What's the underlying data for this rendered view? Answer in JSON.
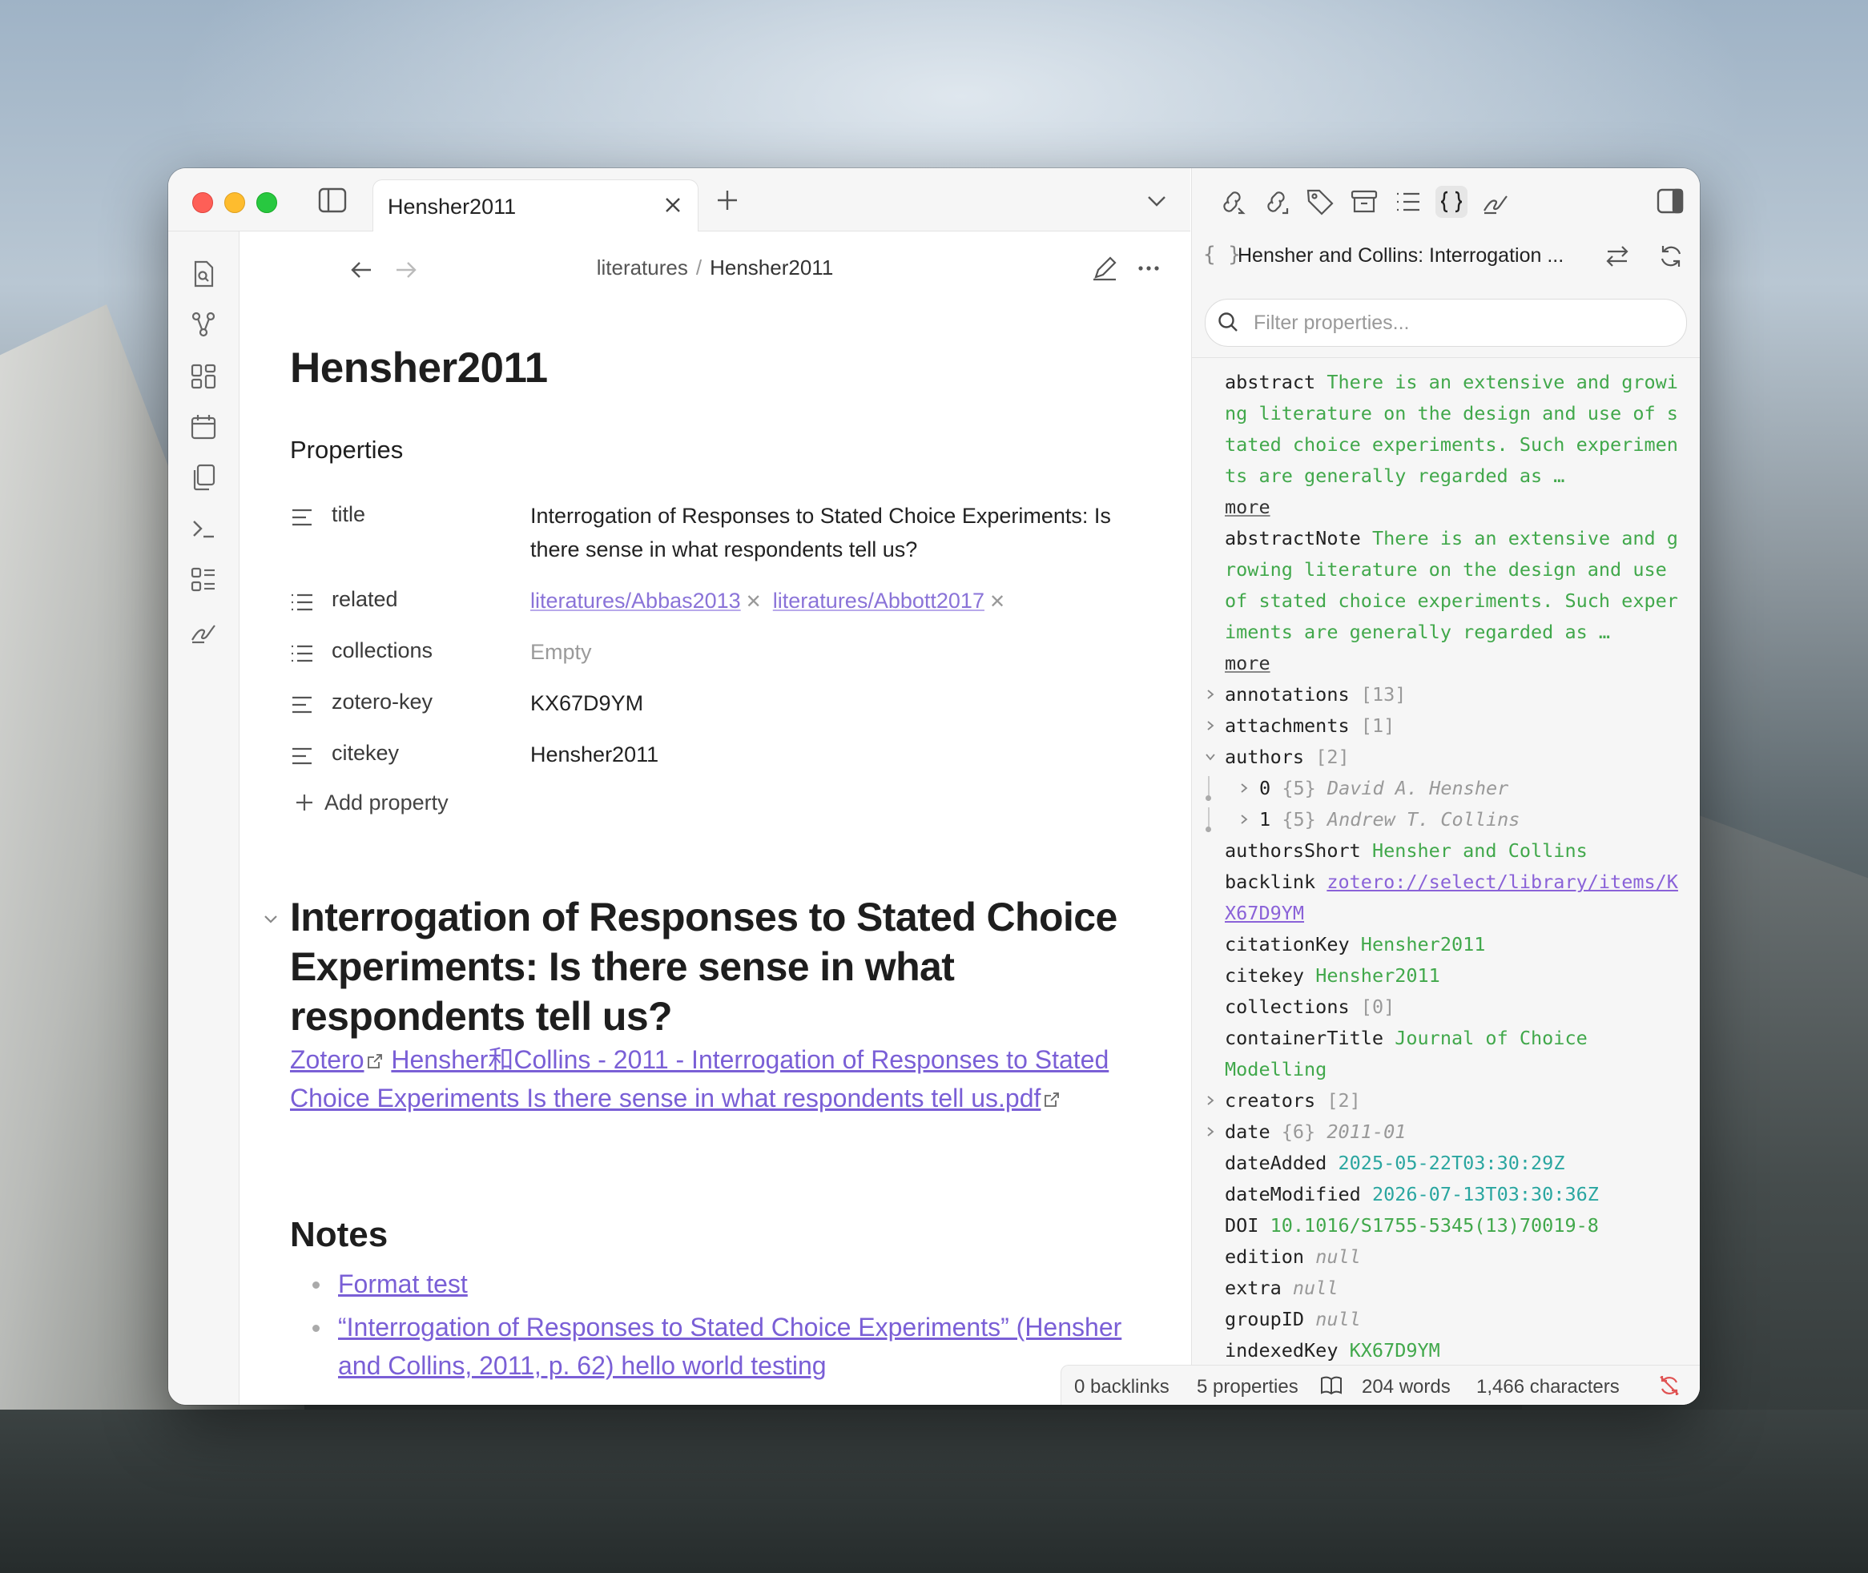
{
  "tab": {
    "title": "Hensher2011"
  },
  "breadcrumb": {
    "folder": "literatures",
    "separator": "/",
    "current": "Hensher2011"
  },
  "note": {
    "title": "Hensher2011",
    "properties_heading": "Properties",
    "properties": [
      {
        "key": "title",
        "value": "Interrogation of Responses to Stated Choice Experiments: Is there sense in what respondents tell us?"
      },
      {
        "key": "related",
        "links": [
          "literatures/Abbas2013",
          "literatures/Abbott2017"
        ]
      },
      {
        "key": "collections",
        "value": "Empty"
      },
      {
        "key": "zotero-key",
        "value": "KX67D9YM"
      },
      {
        "key": "citekey",
        "value": "Hensher2011"
      }
    ],
    "add_property": "Add property",
    "heading": "Interrogation of Responses to Stated Choice Experiments: Is there sense in what respondents tell us?",
    "zotero_link": "Zotero",
    "pdf_link": "Hensher和Collins - 2011 - Interrogation of Responses to Stated Choice Experiments Is there sense in what respondents tell us.pdf",
    "notes_heading": "Notes",
    "notes": [
      "Format test",
      "“Interrogation of Responses to Stated Choice Experiments” (Hensher and Collins, 2011, p. 62) hello world testing"
    ]
  },
  "right_panel": {
    "brace": "{ }",
    "title": "Hensher and Collins: Interrogation ...",
    "filter_placeholder": "Filter properties...",
    "abstract_key": "abstract",
    "abstract_text": "There is an extensive and growing literature on the design and use of stated choice experiments. Such experiments are generally regarded as …",
    "abstractNote_key": "abstractNote",
    "abstractNote_text": "There is an extensive and growing literature on the design and use of stated choice experiments. Such experiments are generally regarded as …",
    "more": "more",
    "annotations": {
      "key": "annotations",
      "count": "[13]"
    },
    "attachments": {
      "key": "attachments",
      "count": "[1]"
    },
    "authors": {
      "key": "authors",
      "count": "[2]"
    },
    "author0": {
      "index": "0",
      "count": "{5}",
      "name": "David A. Hensher"
    },
    "author1": {
      "index": "1",
      "count": "{5}",
      "name": "Andrew T. Collins"
    },
    "authorsShort": {
      "key": "authorsShort",
      "value": "Hensher and Collins"
    },
    "backlink": {
      "key": "backlink",
      "value": "zotero://select/library/items/KX67D9YM"
    },
    "citationKey": {
      "key": "citationKey",
      "value": "Hensher2011"
    },
    "citekey": {
      "key": "citekey",
      "value": "Hensher2011"
    },
    "collections": {
      "key": "collections",
      "count": "[0]"
    },
    "containerTitle": {
      "key": "containerTitle",
      "value": "Journal of Choice Modelling"
    },
    "creators": {
      "key": "creators",
      "count": "[2]"
    },
    "date": {
      "key": "date",
      "count": "{6}",
      "value": "2011-01"
    },
    "dateAdded": {
      "key": "dateAdded",
      "value": "2025-05-22T03:30:29Z"
    },
    "dateModified": {
      "key": "dateModified",
      "value": "2026-07-13T03:30:36Z"
    },
    "DOI": {
      "key": "DOI",
      "value": "10.1016/S1755-5345(13)70019-8"
    },
    "edition": {
      "key": "edition",
      "value": "null"
    },
    "extra": {
      "key": "extra",
      "value": "null"
    },
    "groupID": {
      "key": "groupID",
      "value": "null"
    },
    "indexedKey": {
      "key": "indexedKey",
      "value": "KX67D9YM"
    }
  },
  "status": {
    "backlinks": "0 backlinks",
    "properties": "5 properties",
    "words": "204 words",
    "characters": "1,466 characters"
  },
  "colors": {
    "accent": "#7a5fd6",
    "json_string": "#41a84b",
    "json_date": "#2aa6a0"
  }
}
